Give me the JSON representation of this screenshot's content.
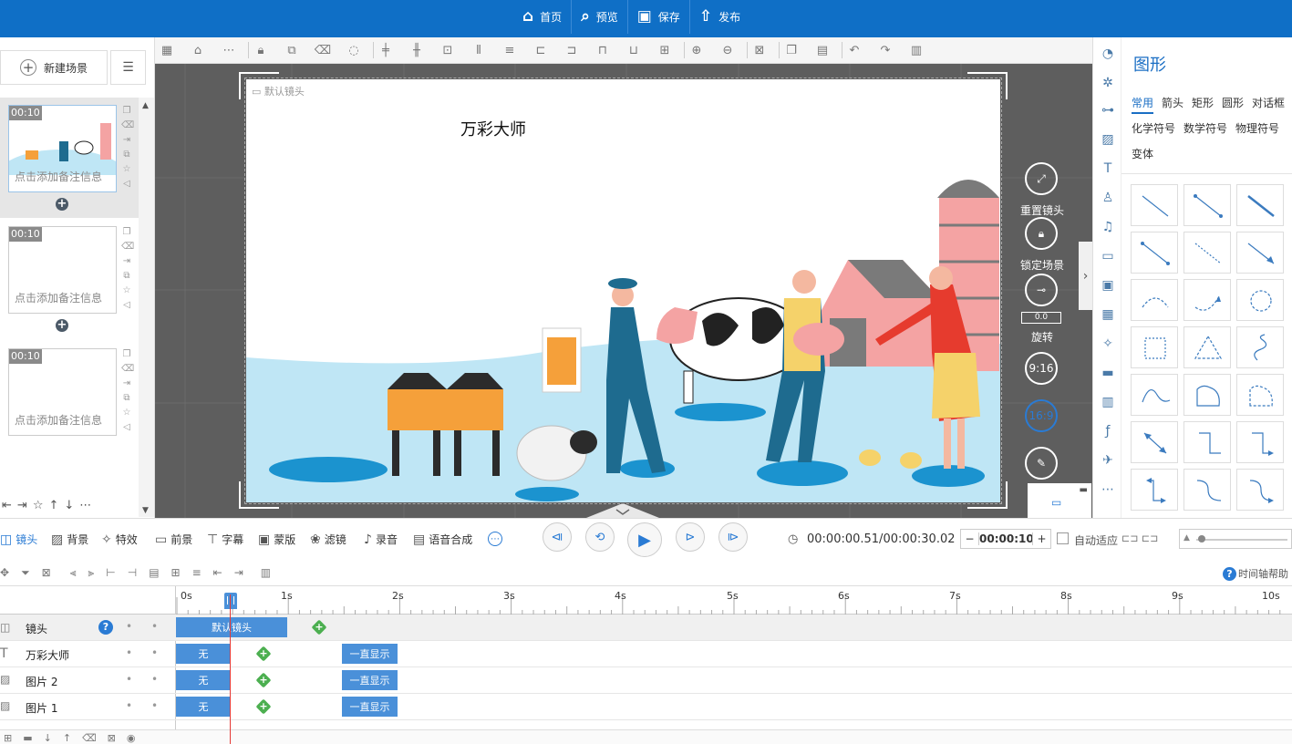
{
  "topnav": {
    "items": [
      {
        "label": "首页",
        "icon": "home-icon"
      },
      {
        "label": "预览",
        "icon": "preview-icon"
      },
      {
        "label": "保存",
        "icon": "save-icon"
      },
      {
        "label": "发布",
        "icon": "publish-icon"
      }
    ]
  },
  "scenes": {
    "new_scene_label": "新建场景",
    "items": [
      {
        "duration": "00:10",
        "note": "点击添加备注信息",
        "selected": true
      },
      {
        "duration": "00:10",
        "note": "点击添加备注信息",
        "selected": false
      },
      {
        "duration": "00:10",
        "note": "点击添加备注信息",
        "selected": false
      }
    ]
  },
  "stage": {
    "lens_label": "默认镜头",
    "title": "万彩大师"
  },
  "right_tools": {
    "reset_lens": "重置镜头",
    "lock_scene": "锁定场景",
    "rotate_value": "0.0",
    "rotate": "旋转",
    "ratio_916": "9:16",
    "ratio_169": "16:9"
  },
  "shape_panel": {
    "title": "图形",
    "tabs_row1": [
      "常用",
      "箭头",
      "矩形",
      "圆形",
      "对话框"
    ],
    "tabs_row2": [
      "化学符号",
      "数学符号",
      "物理符号"
    ],
    "tabs_row3": [
      "变体"
    ],
    "active_tab": "常用"
  },
  "playbar": {
    "tabs": [
      {
        "label": "镜头",
        "icon": "camera-icon",
        "active": true
      },
      {
        "label": "背景",
        "icon": "background-icon"
      },
      {
        "label": "特效",
        "icon": "effects-icon"
      },
      {
        "label": "前景",
        "icon": "foreground-icon"
      },
      {
        "label": "字幕",
        "icon": "subtitle-icon"
      },
      {
        "label": "蒙版",
        "icon": "mask-icon"
      },
      {
        "label": "滤镜",
        "icon": "filter-icon"
      },
      {
        "label": "录音",
        "icon": "mic-icon"
      },
      {
        "label": "语音合成",
        "icon": "tts-icon"
      }
    ],
    "time": "00:00:00.51/00:00:30.02",
    "duration": "00:00:10.00",
    "auto_fit": "自动适应"
  },
  "timeline": {
    "help": "时间轴帮助",
    "ticks": [
      "0s",
      "1s",
      "2s",
      "3s",
      "4s",
      "5s",
      "6s",
      "7s",
      "8s",
      "9s",
      "10s"
    ],
    "tracks": [
      {
        "name": "镜头",
        "icon": "camera-icon",
        "block": "默认镜头"
      },
      {
        "name": "万彩大师",
        "icon": "text-icon",
        "enter": "无",
        "exit": "一直显示"
      },
      {
        "name": "图片 2",
        "icon": "image-icon",
        "enter": "无",
        "exit": "一直显示"
      },
      {
        "name": "图片 1",
        "icon": "image-icon",
        "enter": "无",
        "exit": "一直显示"
      }
    ]
  },
  "colors": {
    "brand": "#0f6fc6",
    "accent": "#1a6ec4",
    "block": "#4a90d9",
    "playhead": "#e53935",
    "keyframe": "#4caf50"
  }
}
